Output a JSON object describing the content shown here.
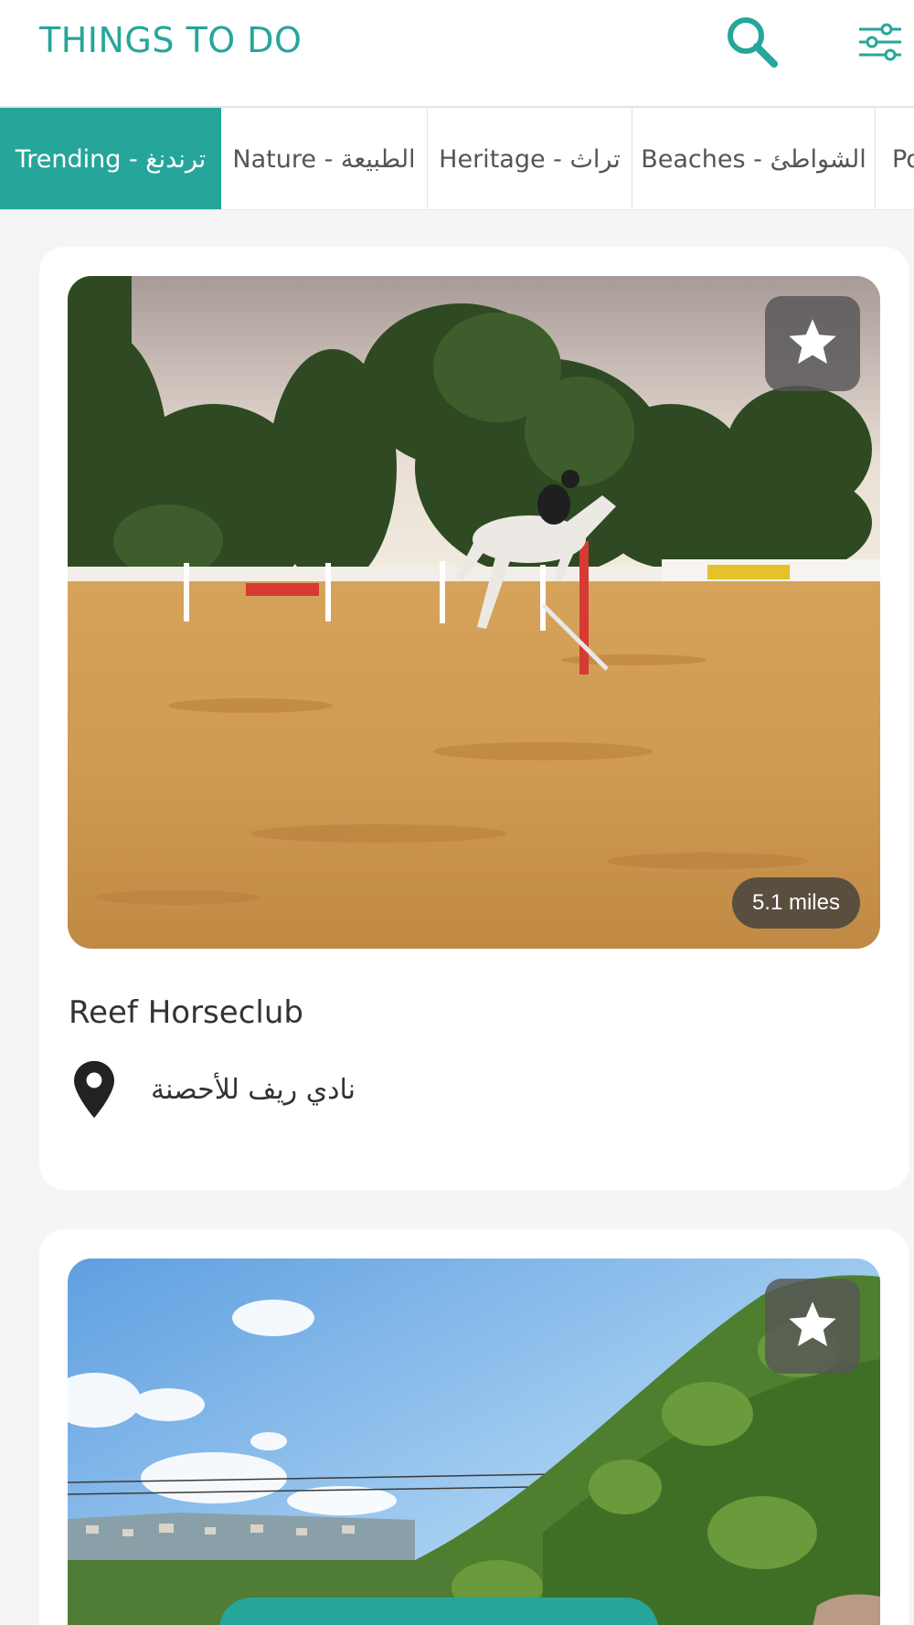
{
  "header": {
    "title": "THINGS TO DO",
    "icons": [
      "search-icon",
      "filter-sliders-icon"
    ]
  },
  "tabs": [
    {
      "label": "Trending - ترندنغ",
      "active": true
    },
    {
      "label": "Nature - الطبيعة",
      "active": false
    },
    {
      "label": "Heritage - تراث",
      "active": false
    },
    {
      "label": "Beaches - الشواطئ",
      "active": false
    },
    {
      "label": "Po",
      "active": false
    }
  ],
  "cards": [
    {
      "title": "Reef Horseclub",
      "location": "نادي ريف للأحصنة",
      "distance": "5.1 miles",
      "image": "show-jumping-arena",
      "favorite_icon": "star-icon",
      "location_icon": "map-pin-icon"
    },
    {
      "image": "green-hills-valley",
      "favorite_icon": "star-icon"
    }
  ],
  "colors": {
    "accent": "#26a69a",
    "background": "#f5f5f5",
    "card": "#ffffff"
  }
}
